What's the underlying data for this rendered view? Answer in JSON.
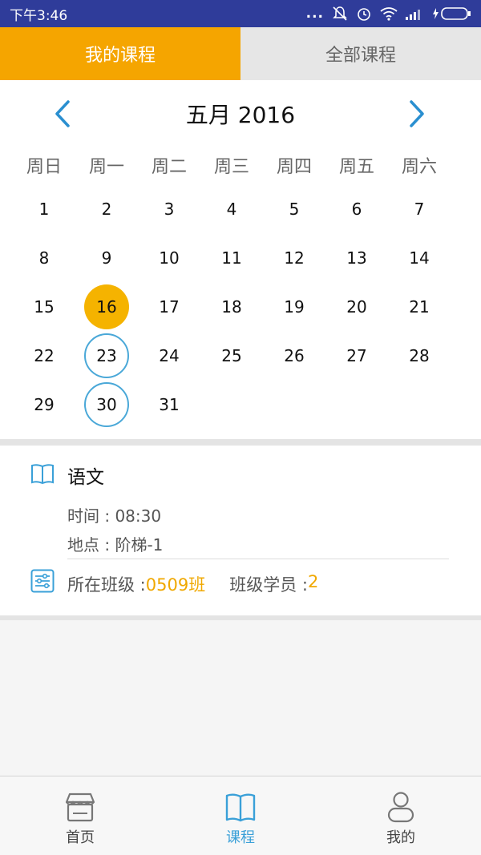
{
  "statusbar": {
    "time": "下午3:46",
    "more": "..."
  },
  "tabs": {
    "my_courses": "我的课程",
    "all_courses": "全部课程"
  },
  "calendar": {
    "title": "五月 2016",
    "weekdays": [
      "周日",
      "周一",
      "周二",
      "周三",
      "周四",
      "周五",
      "周六"
    ],
    "weeks": [
      [
        "1",
        "2",
        "3",
        "4",
        "5",
        "6",
        "7"
      ],
      [
        "8",
        "9",
        "10",
        "11",
        "12",
        "13",
        "14"
      ],
      [
        "15",
        "16",
        "17",
        "18",
        "19",
        "20",
        "21"
      ],
      [
        "22",
        "23",
        "24",
        "25",
        "26",
        "27",
        "28"
      ],
      [
        "29",
        "30",
        "31",
        "",
        "",
        "",
        ""
      ]
    ],
    "today": "16",
    "marked_days": [
      "23",
      "30"
    ]
  },
  "course": {
    "name": "语文",
    "time": "时间 : 08:30",
    "place": "地点 : 阶梯-1",
    "class_label": "所在班级 : ",
    "class_value": "0509班",
    "students_label": "班级学员 : ",
    "students_value": "2"
  },
  "bottom_nav": {
    "home": "首页",
    "courses": "课程",
    "mine": "我的"
  },
  "colors": {
    "accent": "#f5a500",
    "blue": "#3aa0d8",
    "statusbar": "#2f3c9a"
  }
}
